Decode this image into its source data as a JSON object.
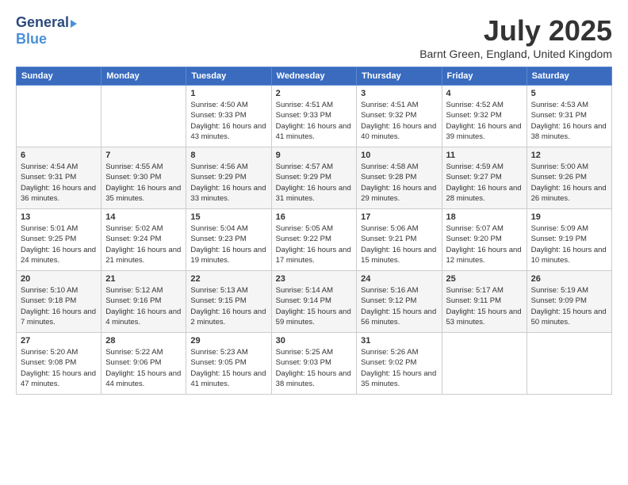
{
  "header": {
    "logo_general": "General",
    "logo_blue": "Blue",
    "title": "July 2025",
    "subtitle": "Barnt Green, England, United Kingdom"
  },
  "weekdays": [
    "Sunday",
    "Monday",
    "Tuesday",
    "Wednesday",
    "Thursday",
    "Friday",
    "Saturday"
  ],
  "weeks": [
    [
      {
        "day": "",
        "detail": ""
      },
      {
        "day": "",
        "detail": ""
      },
      {
        "day": "1",
        "detail": "Sunrise: 4:50 AM\nSunset: 9:33 PM\nDaylight: 16 hours and 43 minutes."
      },
      {
        "day": "2",
        "detail": "Sunrise: 4:51 AM\nSunset: 9:33 PM\nDaylight: 16 hours and 41 minutes."
      },
      {
        "day": "3",
        "detail": "Sunrise: 4:51 AM\nSunset: 9:32 PM\nDaylight: 16 hours and 40 minutes."
      },
      {
        "day": "4",
        "detail": "Sunrise: 4:52 AM\nSunset: 9:32 PM\nDaylight: 16 hours and 39 minutes."
      },
      {
        "day": "5",
        "detail": "Sunrise: 4:53 AM\nSunset: 9:31 PM\nDaylight: 16 hours and 38 minutes."
      }
    ],
    [
      {
        "day": "6",
        "detail": "Sunrise: 4:54 AM\nSunset: 9:31 PM\nDaylight: 16 hours and 36 minutes."
      },
      {
        "day": "7",
        "detail": "Sunrise: 4:55 AM\nSunset: 9:30 PM\nDaylight: 16 hours and 35 minutes."
      },
      {
        "day": "8",
        "detail": "Sunrise: 4:56 AM\nSunset: 9:29 PM\nDaylight: 16 hours and 33 minutes."
      },
      {
        "day": "9",
        "detail": "Sunrise: 4:57 AM\nSunset: 9:29 PM\nDaylight: 16 hours and 31 minutes."
      },
      {
        "day": "10",
        "detail": "Sunrise: 4:58 AM\nSunset: 9:28 PM\nDaylight: 16 hours and 29 minutes."
      },
      {
        "day": "11",
        "detail": "Sunrise: 4:59 AM\nSunset: 9:27 PM\nDaylight: 16 hours and 28 minutes."
      },
      {
        "day": "12",
        "detail": "Sunrise: 5:00 AM\nSunset: 9:26 PM\nDaylight: 16 hours and 26 minutes."
      }
    ],
    [
      {
        "day": "13",
        "detail": "Sunrise: 5:01 AM\nSunset: 9:25 PM\nDaylight: 16 hours and 24 minutes."
      },
      {
        "day": "14",
        "detail": "Sunrise: 5:02 AM\nSunset: 9:24 PM\nDaylight: 16 hours and 21 minutes."
      },
      {
        "day": "15",
        "detail": "Sunrise: 5:04 AM\nSunset: 9:23 PM\nDaylight: 16 hours and 19 minutes."
      },
      {
        "day": "16",
        "detail": "Sunrise: 5:05 AM\nSunset: 9:22 PM\nDaylight: 16 hours and 17 minutes."
      },
      {
        "day": "17",
        "detail": "Sunrise: 5:06 AM\nSunset: 9:21 PM\nDaylight: 16 hours and 15 minutes."
      },
      {
        "day": "18",
        "detail": "Sunrise: 5:07 AM\nSunset: 9:20 PM\nDaylight: 16 hours and 12 minutes."
      },
      {
        "day": "19",
        "detail": "Sunrise: 5:09 AM\nSunset: 9:19 PM\nDaylight: 16 hours and 10 minutes."
      }
    ],
    [
      {
        "day": "20",
        "detail": "Sunrise: 5:10 AM\nSunset: 9:18 PM\nDaylight: 16 hours and 7 minutes."
      },
      {
        "day": "21",
        "detail": "Sunrise: 5:12 AM\nSunset: 9:16 PM\nDaylight: 16 hours and 4 minutes."
      },
      {
        "day": "22",
        "detail": "Sunrise: 5:13 AM\nSunset: 9:15 PM\nDaylight: 16 hours and 2 minutes."
      },
      {
        "day": "23",
        "detail": "Sunrise: 5:14 AM\nSunset: 9:14 PM\nDaylight: 15 hours and 59 minutes."
      },
      {
        "day": "24",
        "detail": "Sunrise: 5:16 AM\nSunset: 9:12 PM\nDaylight: 15 hours and 56 minutes."
      },
      {
        "day": "25",
        "detail": "Sunrise: 5:17 AM\nSunset: 9:11 PM\nDaylight: 15 hours and 53 minutes."
      },
      {
        "day": "26",
        "detail": "Sunrise: 5:19 AM\nSunset: 9:09 PM\nDaylight: 15 hours and 50 minutes."
      }
    ],
    [
      {
        "day": "27",
        "detail": "Sunrise: 5:20 AM\nSunset: 9:08 PM\nDaylight: 15 hours and 47 minutes."
      },
      {
        "day": "28",
        "detail": "Sunrise: 5:22 AM\nSunset: 9:06 PM\nDaylight: 15 hours and 44 minutes."
      },
      {
        "day": "29",
        "detail": "Sunrise: 5:23 AM\nSunset: 9:05 PM\nDaylight: 15 hours and 41 minutes."
      },
      {
        "day": "30",
        "detail": "Sunrise: 5:25 AM\nSunset: 9:03 PM\nDaylight: 15 hours and 38 minutes."
      },
      {
        "day": "31",
        "detail": "Sunrise: 5:26 AM\nSunset: 9:02 PM\nDaylight: 15 hours and 35 minutes."
      },
      {
        "day": "",
        "detail": ""
      },
      {
        "day": "",
        "detail": ""
      }
    ]
  ]
}
